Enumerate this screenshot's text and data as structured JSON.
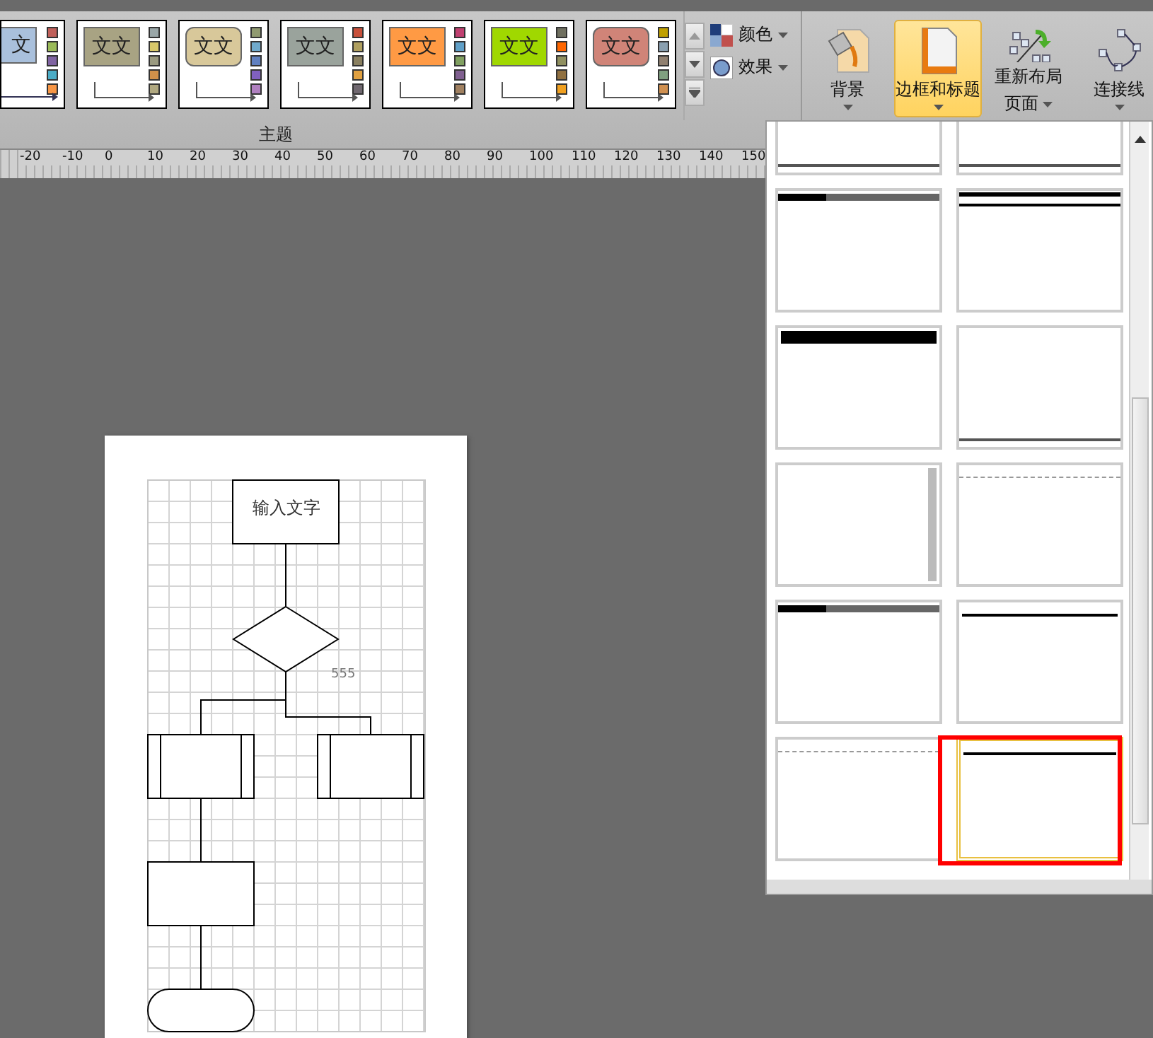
{
  "ribbon": {
    "themes": [
      {
        "label": "文",
        "color": "#a9c0dc"
      },
      {
        "label": "文文",
        "color": "#a8a383"
      },
      {
        "label": "文文",
        "color": "#d8c89a"
      },
      {
        "label": "文文",
        "color": "#9aa39c"
      },
      {
        "label": "文文",
        "color": "#ff9a44"
      },
      {
        "label": "文文",
        "color": "#a0d800"
      },
      {
        "label": "文文",
        "color": "#d08478"
      }
    ],
    "menu_items": [
      {
        "label": "颜色"
      },
      {
        "label": "效果"
      }
    ],
    "buttons": [
      {
        "selected": false,
        "lines": [
          "背景"
        ]
      },
      {
        "selected": true,
        "lines": [
          "边框和标题"
        ]
      },
      {
        "selected": false,
        "lines": [
          "重新布局",
          "页面"
        ]
      },
      {
        "selected": false,
        "lines": [
          "连接线"
        ]
      }
    ],
    "group_label": "主题"
  },
  "ruler": [
    "-20",
    "-10",
    "0",
    "10",
    "20",
    "30",
    "40",
    "50",
    "60",
    "70",
    "80",
    "90",
    "100",
    "110",
    "120",
    "130",
    "140",
    "150"
  ],
  "diagram": {
    "title_box": "输入文字",
    "note": "555"
  },
  "border_gallery": [
    {
      "kind": "line",
      "selected": false
    },
    {
      "kind": "line",
      "selected": false
    },
    {
      "kind": "bar",
      "selected": false
    },
    {
      "kind": "double",
      "selected": false
    },
    {
      "kind": "black",
      "selected": false
    },
    {
      "kind": "line",
      "selected": false
    },
    {
      "kind": "side",
      "selected": false
    },
    {
      "kind": "dashed",
      "selected": false
    },
    {
      "kind": "bar",
      "selected": false
    },
    {
      "kind": "center",
      "selected": false
    },
    {
      "kind": "dashed",
      "selected": false
    },
    {
      "kind": "center",
      "selected": true
    }
  ]
}
